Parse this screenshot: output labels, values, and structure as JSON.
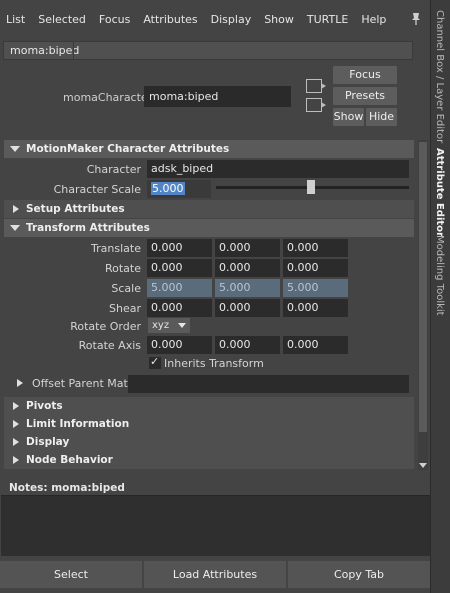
{
  "menu": [
    "List",
    "Selected",
    "Focus",
    "Attributes",
    "Display",
    "Show",
    "TURTLE",
    "Help"
  ],
  "side_tabs": {
    "channel_box": "Channel Box / Layer Editor",
    "attribute_editor": "Attribute Editor",
    "modeling_toolkit": "Modeling Toolkit"
  },
  "node_tab": "moma:biped",
  "header": {
    "character_label": "momaCharacter:",
    "character_value": "moma:biped",
    "focus": "Focus",
    "presets": "Presets",
    "show": "Show",
    "hide": "Hide"
  },
  "motionmaker": {
    "title": "MotionMaker Character Attributes",
    "character_label": "Character",
    "character_value": "adsk_biped",
    "scale_label": "Character Scale",
    "scale_value": "5.000",
    "scale_slider_fraction": 0.49
  },
  "setup": {
    "title": "Setup Attributes"
  },
  "transform": {
    "title": "Transform Attributes",
    "translate": {
      "label": "Translate",
      "values": [
        "0.000",
        "0.000",
        "0.000"
      ]
    },
    "rotate": {
      "label": "Rotate",
      "values": [
        "0.000",
        "0.000",
        "0.000"
      ]
    },
    "scale": {
      "label": "Scale",
      "values": [
        "5.000",
        "5.000",
        "5.000"
      ]
    },
    "shear": {
      "label": "Shear",
      "values": [
        "0.000",
        "0.000",
        "0.000"
      ]
    },
    "rotate_order": {
      "label": "Rotate Order",
      "value": "xyz"
    },
    "rotate_axis": {
      "label": "Rotate Axis",
      "values": [
        "0.000",
        "0.000",
        "0.000"
      ]
    },
    "inherits": "Inherits Transform"
  },
  "offset_parent": "Offset Parent Matrix",
  "sections": [
    "Pivots",
    "Limit Information",
    "Display",
    "Node Behavior"
  ],
  "notes_label": "Notes:  moma:biped",
  "bottom": {
    "select": "Select",
    "load": "Load Attributes",
    "copy": "Copy Tab"
  }
}
